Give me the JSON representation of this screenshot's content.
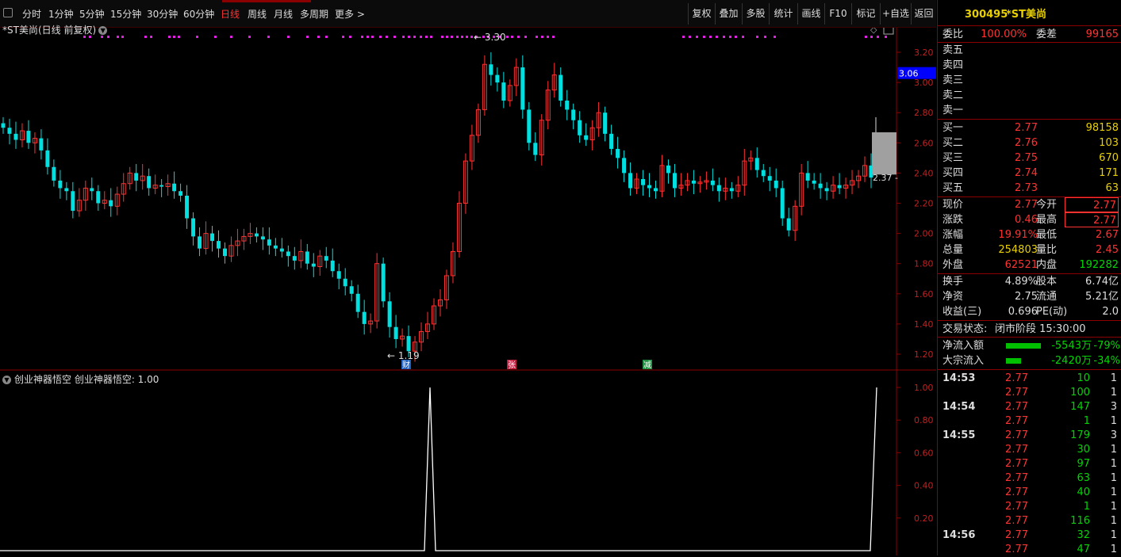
{
  "toolbar": {
    "periods": [
      "分时",
      "1分钟",
      "5分钟",
      "15分钟",
      "30分钟",
      "60分钟",
      "日线",
      "周线",
      "月线",
      "多周期",
      "更多 >"
    ],
    "active_period": "日线",
    "actions": [
      "复权",
      "叠加",
      "多股",
      "统计",
      "画线",
      "F10",
      "标记",
      "+自选",
      "返回"
    ]
  },
  "chart": {
    "title": "*ST美尚(日线 前复权)",
    "y_ticks": [
      "3.20",
      "3.00",
      "2.80",
      "2.60",
      "2.40",
      "2.20",
      "2.00",
      "1.80",
      "1.60",
      "1.40",
      "1.20"
    ],
    "current_price_tag": "3.06",
    "high_label": "3.30",
    "low_label": "1.19",
    "last_label": "2.37",
    "event_marks": [
      "财",
      "张",
      "减"
    ]
  },
  "indicator": {
    "title": "创业神器悟空 创业神器悟空: 1.00",
    "y_ticks": [
      "1.00",
      "0.80",
      "0.60",
      "0.40",
      "0.20"
    ]
  },
  "chart_data": {
    "type": "candlestick",
    "title": "*ST美尚(日线 前复权)",
    "ylim": [
      1.1,
      3.3
    ],
    "high": 3.3,
    "low": 1.19,
    "last": 2.37,
    "indicator_series": {
      "name": "创业神器悟空",
      "ylim": [
        0,
        1.0
      ],
      "spikes_at": [
        "start of rally near 1.19 low",
        "latest bar"
      ]
    }
  },
  "quote": {
    "code": "300495",
    "name": "*ST美尚",
    "wei_bi_label": "委比",
    "wei_bi": "100.00%",
    "wei_cha_label": "委差",
    "wei_cha": "99165",
    "sell": [
      {
        "label": "卖五",
        "price": "",
        "vol": ""
      },
      {
        "label": "卖四",
        "price": "",
        "vol": ""
      },
      {
        "label": "卖三",
        "price": "",
        "vol": ""
      },
      {
        "label": "卖二",
        "price": "",
        "vol": ""
      },
      {
        "label": "卖一",
        "price": "",
        "vol": ""
      }
    ],
    "buy": [
      {
        "label": "买一",
        "price": "2.77",
        "vol": "98158"
      },
      {
        "label": "买二",
        "price": "2.76",
        "vol": "103"
      },
      {
        "label": "买三",
        "price": "2.75",
        "vol": "670"
      },
      {
        "label": "买四",
        "price": "2.74",
        "vol": "171"
      },
      {
        "label": "买五",
        "price": "2.73",
        "vol": "63"
      }
    ],
    "stats": [
      {
        "l1": "现价",
        "v1": "2.77",
        "c1": "red",
        "l2": "今开",
        "v2": "2.77",
        "c2": "red boxed"
      },
      {
        "l1": "涨跌",
        "v1": "0.46",
        "c1": "red",
        "l2": "最高",
        "v2": "2.77",
        "c2": "red boxed"
      },
      {
        "l1": "涨幅",
        "v1": "19.91%",
        "c1": "red",
        "l2": "最低",
        "v2": "2.67",
        "c2": "red"
      },
      {
        "l1": "总量",
        "v1": "254803",
        "c1": "yellow",
        "l2": "量比",
        "v2": "2.45",
        "c2": "red"
      },
      {
        "l1": "外盘",
        "v1": "62521",
        "c1": "red",
        "l2": "内盘",
        "v2": "192282",
        "c2": "green"
      }
    ],
    "stats2": [
      {
        "l1": "换手",
        "v1": "4.89%",
        "l2": "股本",
        "v2": "6.74亿"
      },
      {
        "l1": "净资",
        "v1": "2.75",
        "l2": "流通",
        "v2": "5.21亿"
      },
      {
        "l1": "收益(三)",
        "v1": "0.696",
        "l2": "PE(动)",
        "v2": "2.0"
      }
    ],
    "trade_status_label": "交易状态:",
    "trade_status": "闭市阶段 15:30:00",
    "flows": [
      {
        "label": "净流入额",
        "value": "-5543万",
        "pct": "-79%",
        "bar": 0.79
      },
      {
        "label": "大宗流入",
        "value": "-2420万",
        "pct": "-34%",
        "bar": 0.34
      }
    ],
    "ticks": [
      {
        "time": "14:53",
        "price": "2.77",
        "vol": "10",
        "n": "1"
      },
      {
        "time": "",
        "price": "2.77",
        "vol": "100",
        "n": "1"
      },
      {
        "time": "14:54",
        "price": "2.77",
        "vol": "147",
        "n": "3"
      },
      {
        "time": "",
        "price": "2.77",
        "vol": "1",
        "n": "1"
      },
      {
        "time": "14:55",
        "price": "2.77",
        "vol": "179",
        "n": "3"
      },
      {
        "time": "",
        "price": "2.77",
        "vol": "30",
        "n": "1"
      },
      {
        "time": "",
        "price": "2.77",
        "vol": "97",
        "n": "1"
      },
      {
        "time": "",
        "price": "2.77",
        "vol": "63",
        "n": "1"
      },
      {
        "time": "",
        "price": "2.77",
        "vol": "40",
        "n": "1"
      },
      {
        "time": "",
        "price": "2.77",
        "vol": "1",
        "n": "1"
      },
      {
        "time": "",
        "price": "2.77",
        "vol": "116",
        "n": "1"
      },
      {
        "time": "14:56",
        "price": "2.77",
        "vol": "32",
        "n": "1"
      },
      {
        "time": "",
        "price": "2.77",
        "vol": "47",
        "n": "1"
      }
    ]
  },
  "colors": {
    "up": "#ff3232",
    "down": "#00e0e0",
    "bg": "#000000",
    "axis": "#8b0000"
  }
}
